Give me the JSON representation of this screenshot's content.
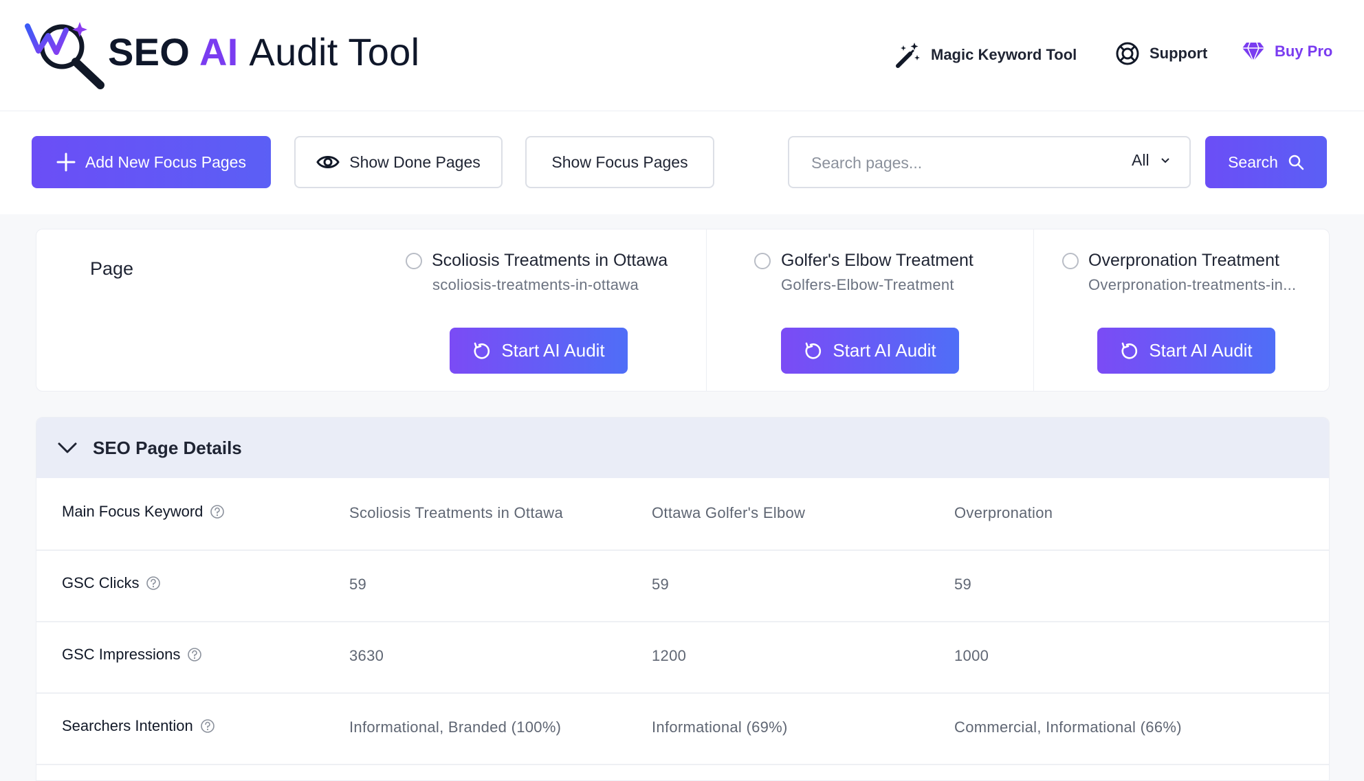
{
  "app": {
    "logo_prefix": "SEO",
    "logo_ai": "AI",
    "logo_suffix": "Audit Tool"
  },
  "nav": {
    "magic_keyword_tool": "Magic Keyword Tool",
    "support": "Support",
    "buy_pro": "Buy Pro"
  },
  "toolbar": {
    "add_new": "Add New Focus Pages",
    "show_done": "Show Done Pages",
    "show_focus": "Show Focus Pages",
    "search_placeholder": "Search pages...",
    "filter_value": "All",
    "search_button": "Search"
  },
  "pages_section": {
    "label": "Page",
    "audit_button": "Start AI Audit",
    "pages": [
      {
        "title": "Scoliosis Treatments in Ottawa",
        "slug": "scoliosis-treatments-in-ottawa"
      },
      {
        "title": "Golfer's Elbow Treatment",
        "slug": "Golfers-Elbow-Treatment"
      },
      {
        "title": "Overpronation Treatment",
        "slug": "Overpronation-treatments-in..."
      }
    ]
  },
  "details": {
    "title": "SEO Page Details",
    "rows": [
      {
        "label": "Main Focus Keyword",
        "values": [
          "Scoliosis Treatments in Ottawa",
          "Ottawa Golfer's Elbow",
          "Overpronation"
        ]
      },
      {
        "label": "GSC Clicks",
        "values": [
          "59",
          "59",
          "59"
        ]
      },
      {
        "label": "GSC Impressions",
        "values": [
          "3630",
          "1200",
          "1000"
        ]
      },
      {
        "label": "Searchers Intention",
        "values": [
          "Informational, Branded (100%)",
          "Informational (69%)",
          "Commercial, Informational (66%)"
        ]
      }
    ]
  },
  "colors": {
    "brand_purple": "#7a3cf0",
    "primary_button": "#6b4ef6",
    "details_header_bg": "#eaedf7"
  }
}
